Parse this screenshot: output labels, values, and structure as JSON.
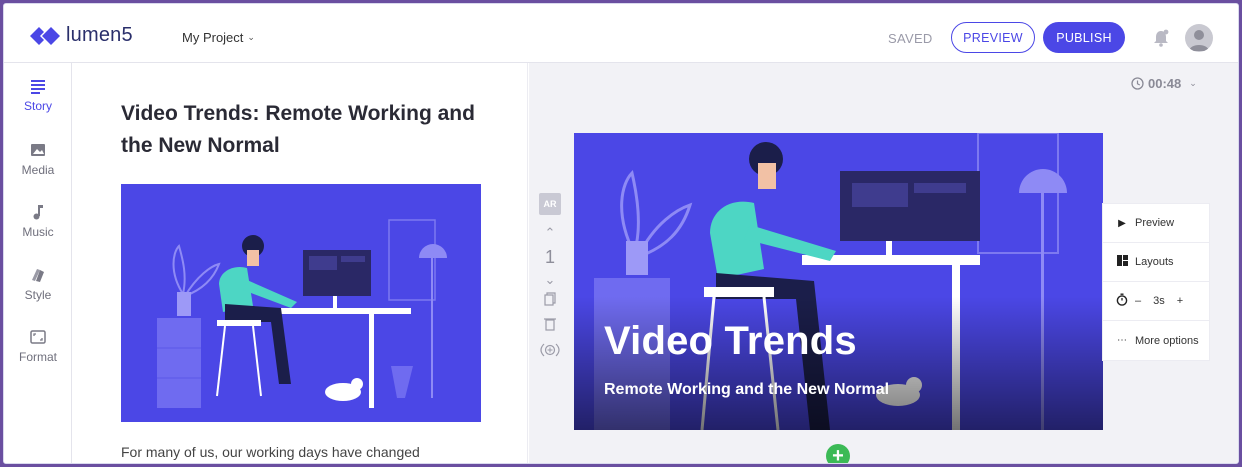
{
  "brand": {
    "name": "lumen5",
    "accent": "#4b47e6"
  },
  "header": {
    "project": "My Project",
    "status": "SAVED",
    "preview_label": "PREVIEW",
    "publish_label": "PUBLISH"
  },
  "sidebar": {
    "items": [
      {
        "label": "Story",
        "icon": "story-icon"
      },
      {
        "label": "Media",
        "icon": "media-icon"
      },
      {
        "label": "Music",
        "icon": "music-icon"
      },
      {
        "label": "Style",
        "icon": "style-icon"
      },
      {
        "label": "Format",
        "icon": "format-icon"
      }
    ]
  },
  "story": {
    "title": "Video Trends: Remote Working and the New Normal",
    "body": "For many of us, our working days have changed"
  },
  "canvas": {
    "duration": "00:48",
    "ar_label": "AR",
    "scene_number": "1",
    "scene_title": "Video Trends",
    "scene_subtitle": "Remote Working and the New Normal"
  },
  "scene_menu": {
    "preview": "Preview",
    "layouts": "Layouts",
    "duration": "3s",
    "minus": "–",
    "plus": "+",
    "more": "More options"
  }
}
